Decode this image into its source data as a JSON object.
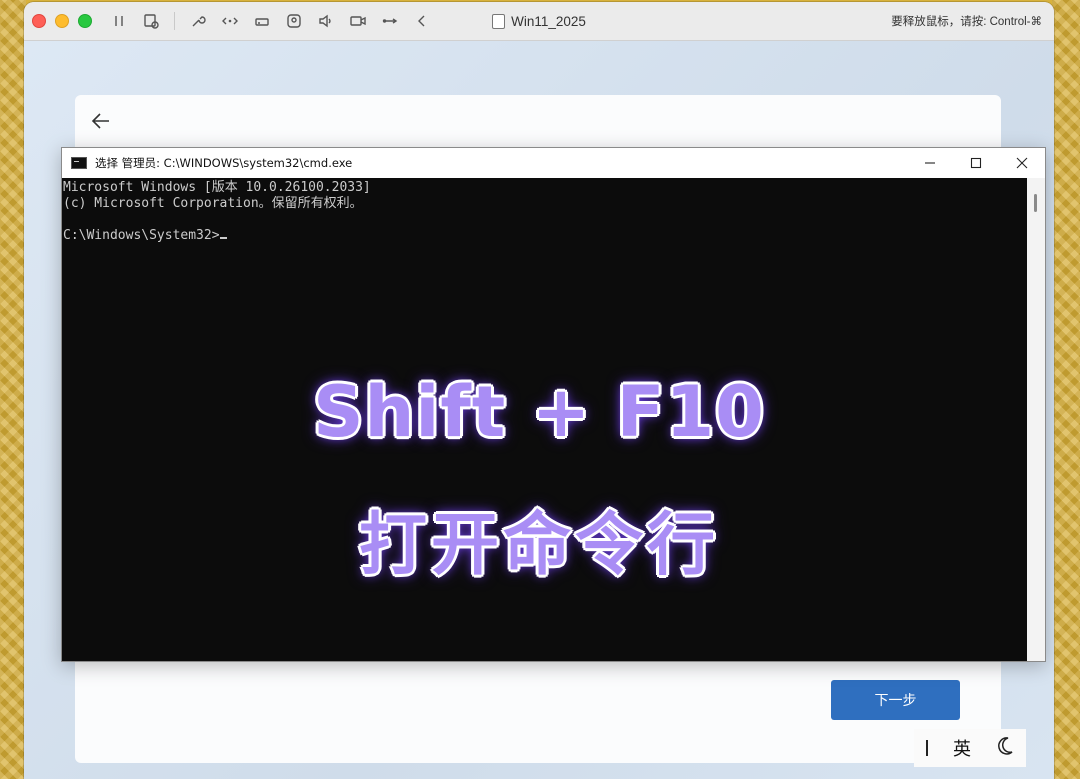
{
  "vm": {
    "title": "Win11_2025",
    "hint": "要释放鼠标，请按: Control-⌘"
  },
  "cmd": {
    "title": "选择 管理员: C:\\WINDOWS\\system32\\cmd.exe",
    "lines": [
      "Microsoft Windows [版本 10.0.26100.2033]",
      "(c) Microsoft Corporation。保留所有权利。",
      "",
      "C:\\Windows\\System32>"
    ]
  },
  "setup": {
    "next_label": "下一步"
  },
  "overlay": {
    "line1": "Shift + F10",
    "line2": "打开命令行"
  },
  "ime": {
    "mode": "英"
  },
  "colors": {
    "next_button": "#2f6fbf",
    "overlay_text": "#a98df5",
    "cmd_background": "#0c0c0c"
  }
}
